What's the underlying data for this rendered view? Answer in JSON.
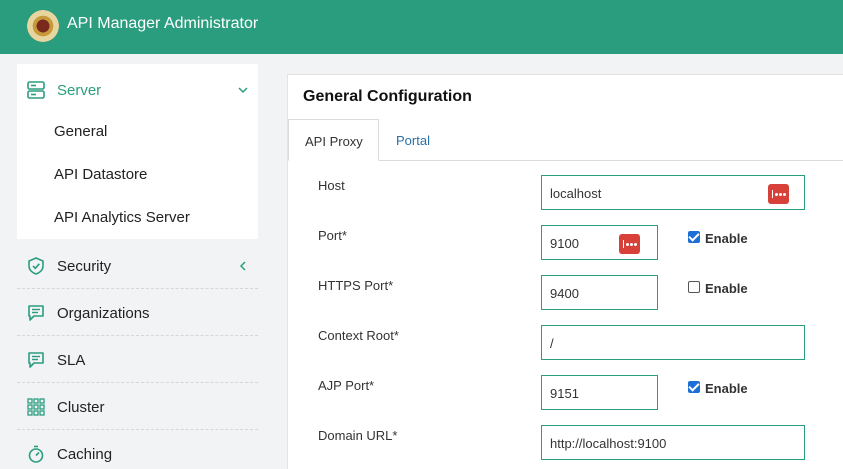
{
  "app": {
    "title": "API Manager Administrator"
  },
  "sidebar": {
    "server": {
      "label": "Server",
      "children": [
        "General",
        "API Datastore",
        "API Analytics Server"
      ]
    },
    "items": [
      {
        "label": "Security",
        "icon": "shield-icon"
      },
      {
        "label": "Organizations",
        "icon": "chat-icon"
      },
      {
        "label": "SLA",
        "icon": "chat-icon"
      },
      {
        "label": "Cluster",
        "icon": "grid-icon"
      },
      {
        "label": "Caching",
        "icon": "stopwatch-icon"
      }
    ]
  },
  "main": {
    "title": "General Configuration",
    "tabs": [
      {
        "label": "API Proxy",
        "active": true
      },
      {
        "label": "Portal",
        "active": false
      }
    ],
    "form": {
      "host": {
        "label": "Host",
        "value": "localhost"
      },
      "port": {
        "label": "Port*",
        "value": "9100",
        "enable_label": "Enable",
        "enabled": true
      },
      "https_port": {
        "label": "HTTPS Port*",
        "value": "9400",
        "enable_label": "Enable",
        "enabled": false
      },
      "context_root": {
        "label": "Context Root*",
        "value": "/"
      },
      "ajp_port": {
        "label": "AJP Port*",
        "value": "9151",
        "enable_label": "Enable",
        "enabled": true
      },
      "domain_url": {
        "label": "Domain URL*",
        "value": "http://localhost:9100"
      }
    }
  },
  "colors": {
    "brand": "#2a9d7e",
    "checkbox": "#1d6fd6",
    "password_manager": "#d8403a"
  }
}
